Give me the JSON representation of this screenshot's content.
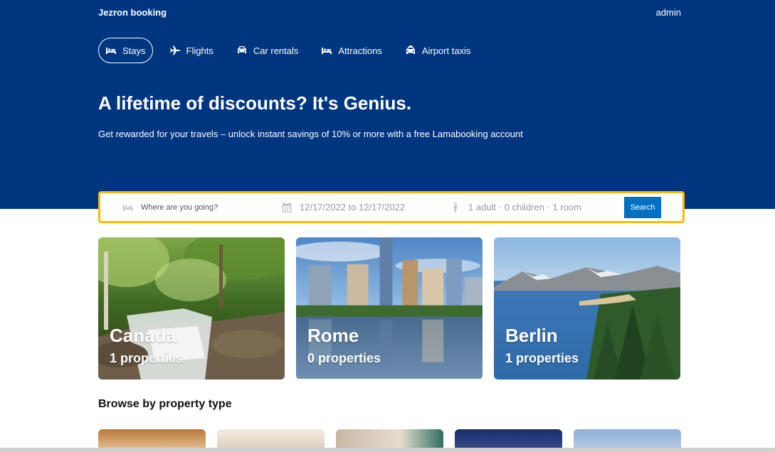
{
  "header": {
    "brand": "Jezron booking",
    "user": "admin",
    "nav": [
      {
        "label": "Stays",
        "icon": "bed-icon",
        "active": true
      },
      {
        "label": "Flights",
        "icon": "plane-icon",
        "active": false
      },
      {
        "label": "Car rentals",
        "icon": "car-icon",
        "active": false
      },
      {
        "label": "Attractions",
        "icon": "bed-icon",
        "active": false
      },
      {
        "label": "Airport taxis",
        "icon": "taxi-icon",
        "active": false
      }
    ],
    "title": "A lifetime of discounts? It's Genius.",
    "subtitle": "Get rewarded for your travels – unlock instant savings of 10% or more with a free Lamabooking account"
  },
  "search": {
    "destination_placeholder": "Where are you going?",
    "dates": "12/17/2022 to 12/17/2022",
    "guests": "1 adult · 0 children · 1 room",
    "button_label": "Search"
  },
  "featured": [
    {
      "title": "Canada",
      "count": "1 properties"
    },
    {
      "title": "Rome",
      "count": "0 properties"
    },
    {
      "title": "Berlin",
      "count": "1 properties"
    }
  ],
  "browse": {
    "title": "Browse by property type"
  },
  "colors": {
    "brand": "#003580",
    "accent": "#febb02",
    "button": "#0071c2"
  }
}
